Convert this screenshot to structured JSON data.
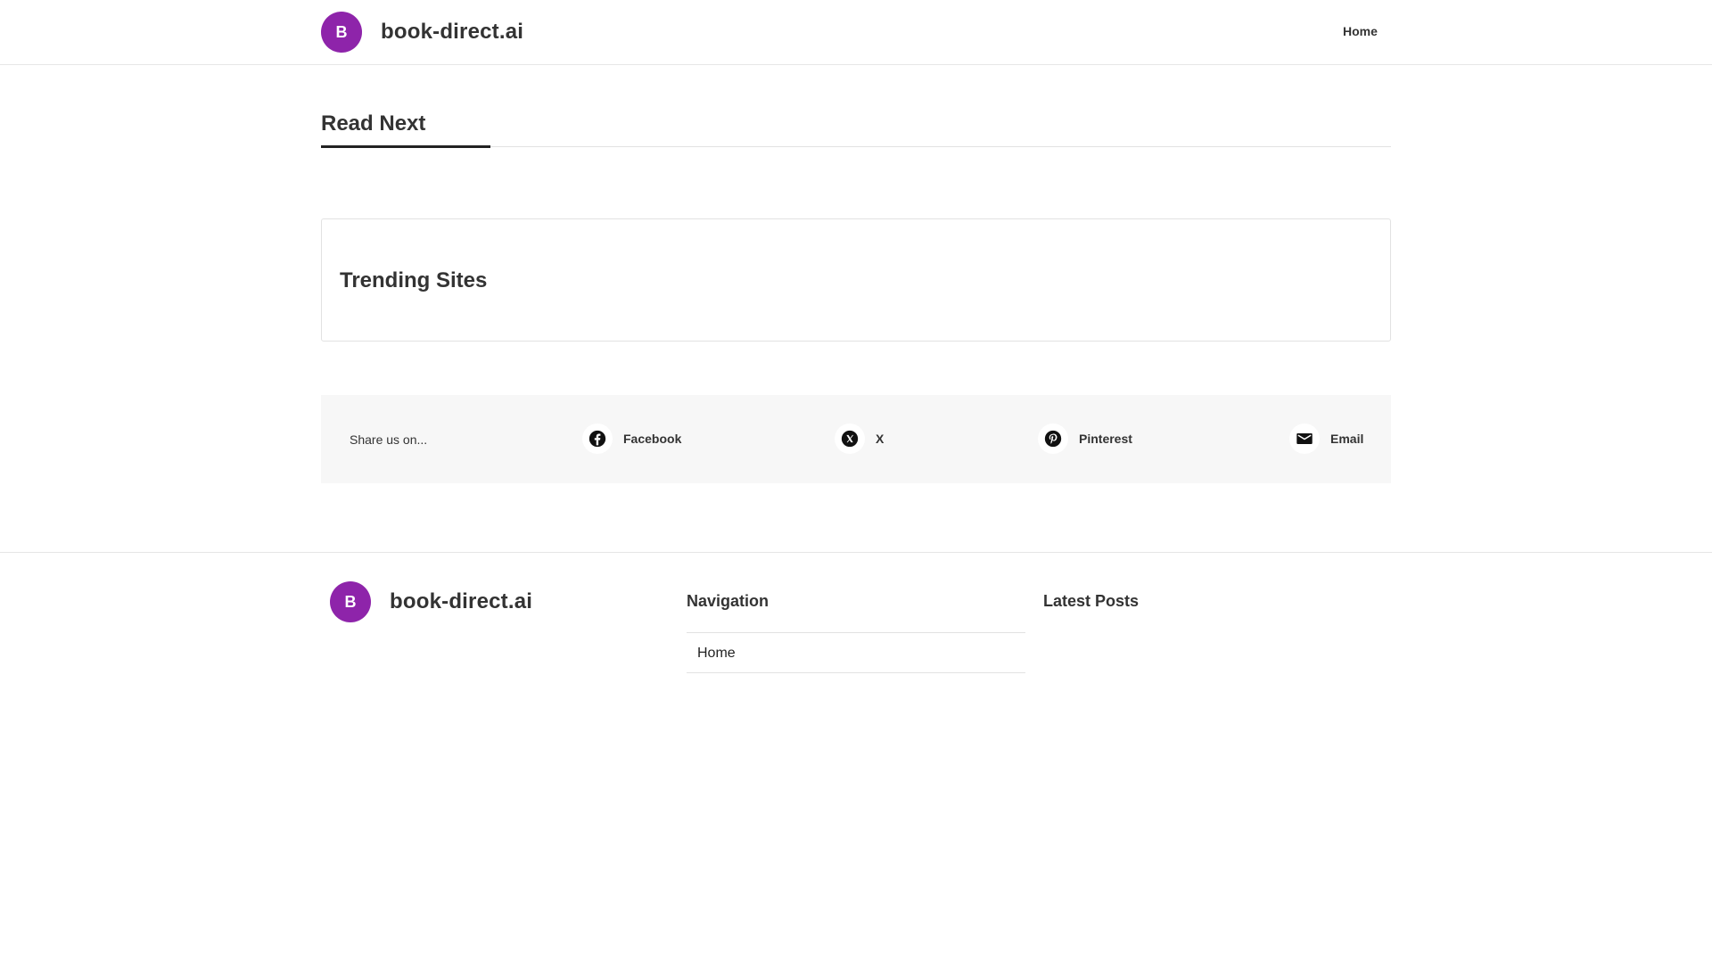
{
  "header": {
    "logo_letter": "B",
    "site_name": "book-direct.ai",
    "nav": [
      {
        "label": "Home"
      }
    ]
  },
  "main": {
    "read_next_title": "Read Next",
    "trending_title": "Trending Sites"
  },
  "share": {
    "label": "Share us on...",
    "items": [
      {
        "label": "Facebook",
        "icon": "facebook-icon"
      },
      {
        "label": "X",
        "icon": "x-icon"
      },
      {
        "label": "Pinterest",
        "icon": "pinterest-icon"
      },
      {
        "label": "Email",
        "icon": "email-icon"
      }
    ]
  },
  "footer": {
    "logo_letter": "B",
    "site_name": "book-direct.ai",
    "navigation_title": "Navigation",
    "navigation_items": [
      {
        "label": "Home"
      }
    ],
    "latest_posts_title": "Latest Posts"
  },
  "colors": {
    "brand": "#8e24aa",
    "text": "#333333",
    "share_background": "#f7f7f7",
    "border": "#e2e2e2"
  }
}
